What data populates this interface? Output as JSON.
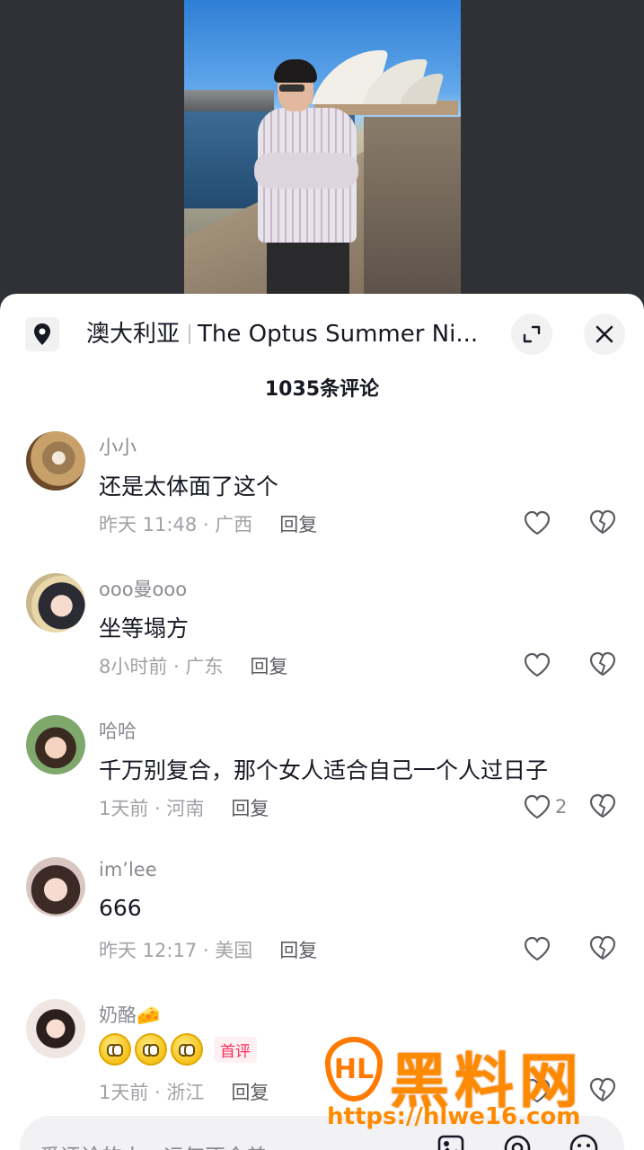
{
  "video": {
    "description_icon": "video-frame"
  },
  "location": {
    "region": "澳大利亚",
    "place": "The Optus Summer Ni..."
  },
  "comment_count_label": "1035条评论",
  "comments": [
    {
      "user": "小小",
      "text": "还是太体面了这个",
      "time": "昨天 11:48",
      "location": "广西",
      "reply": "回复",
      "likes": ""
    },
    {
      "user": "ooo曼ooo",
      "text": "坐等塌方",
      "time": "8小时前",
      "location": "广东",
      "reply": "回复",
      "likes": ""
    },
    {
      "user": "哈哈",
      "text": "千万别复合，那个女人适合自己一个人过日子",
      "time": "1天前",
      "location": "河南",
      "reply": "回复",
      "likes": "2"
    },
    {
      "user": "im’lee",
      "text": "666",
      "time": "昨天 12:17",
      "location": "美国",
      "reply": "回复",
      "likes": ""
    },
    {
      "user": "奶酪🧀",
      "text": "",
      "tag": "首评",
      "time": "1天前",
      "location": "浙江",
      "reply": "回复",
      "likes": ""
    }
  ],
  "input": {
    "placeholder": "爱评论的人，运气不会差"
  },
  "watermark": {
    "logo": "HL",
    "title": "黑料网",
    "url": "https://hlwe16.com"
  },
  "colors": {
    "accent": "#fe2c55",
    "watermark": "#ff8a00"
  }
}
